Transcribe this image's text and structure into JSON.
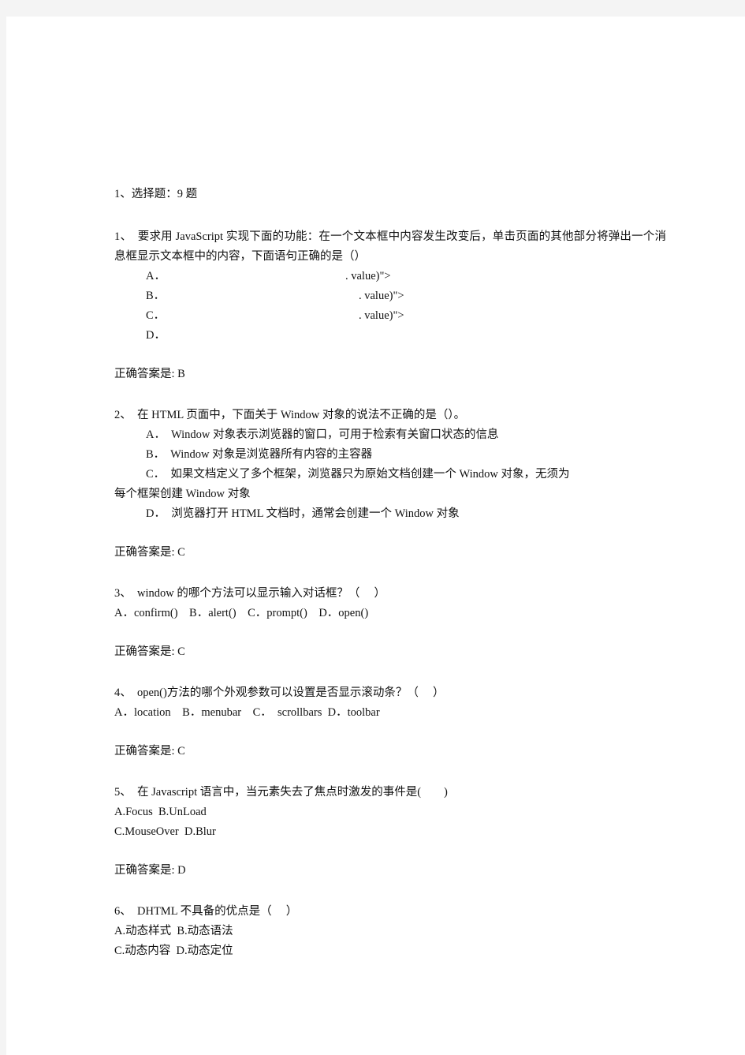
{
  "document": {
    "section_heading": "1、选择题：9 题",
    "answer_prefix": "正确答案是:"
  },
  "questions": [
    {
      "number": "1、",
      "stem": "1、  要求用 JavaScript 实现下面的功能：在一个文本框中内容发生改变后，单击页面的其他部分将弹出一个消息框显示文本框中的内容，下面语句正确的是（）",
      "options": [
        {
          "label": "A．",
          "fragment": ". value)\">"
        },
        {
          "label": "B．",
          "fragment": ". value)\">"
        },
        {
          "label": "C．",
          "fragment": ". value)\">"
        },
        {
          "label": "D．",
          "fragment": ""
        }
      ],
      "answer": "B"
    },
    {
      "number": "2、",
      "stem": "2、  在 HTML 页面中，下面关于 Window 对象的说法不正确的是（）。",
      "options": [
        {
          "text": "A．  Window 对象表示浏览器的窗口，可用于检索有关窗口状态的信息"
        },
        {
          "text": "B．  Window 对象是浏览器所有内容的主容器"
        },
        {
          "text": "C．  如果文档定义了多个框架，浏览器只为原始文档创建一个 Window 对象，无须为",
          "wrap": "每个框架创建 Window 对象"
        },
        {
          "text": "D．  浏览器打开 HTML 文档时，通常会创建一个 Window 对象"
        }
      ],
      "answer": "C"
    },
    {
      "number": "3、",
      "stem": "3、  window 的哪个方法可以显示输入对话框？（     ）",
      "options_line": "A．confirm()    B．alert()    C．prompt()    D．open()",
      "answer": "C"
    },
    {
      "number": "4、",
      "stem": "4、  open()方法的哪个外观参数可以设置是否显示滚动条？（     ）",
      "options_line": "A．location    B．menubar    C．  scrollbars  D．toolbar",
      "answer": "C"
    },
    {
      "number": "5、",
      "stem": "5、  在 Javascript 语言中，当元素失去了焦点时激发的事件是(        )",
      "options_line_1": "A.Focus  B.UnLoad",
      "options_line_2": "C.MouseOver  D.Blur",
      "answer": "D"
    },
    {
      "number": "6、",
      "stem": "6、  DHTML 不具备的优点是（     ）",
      "options_line_1": "A.动态样式  B.动态语法",
      "options_line_2": "C.动态内容  D.动态定位"
    }
  ]
}
